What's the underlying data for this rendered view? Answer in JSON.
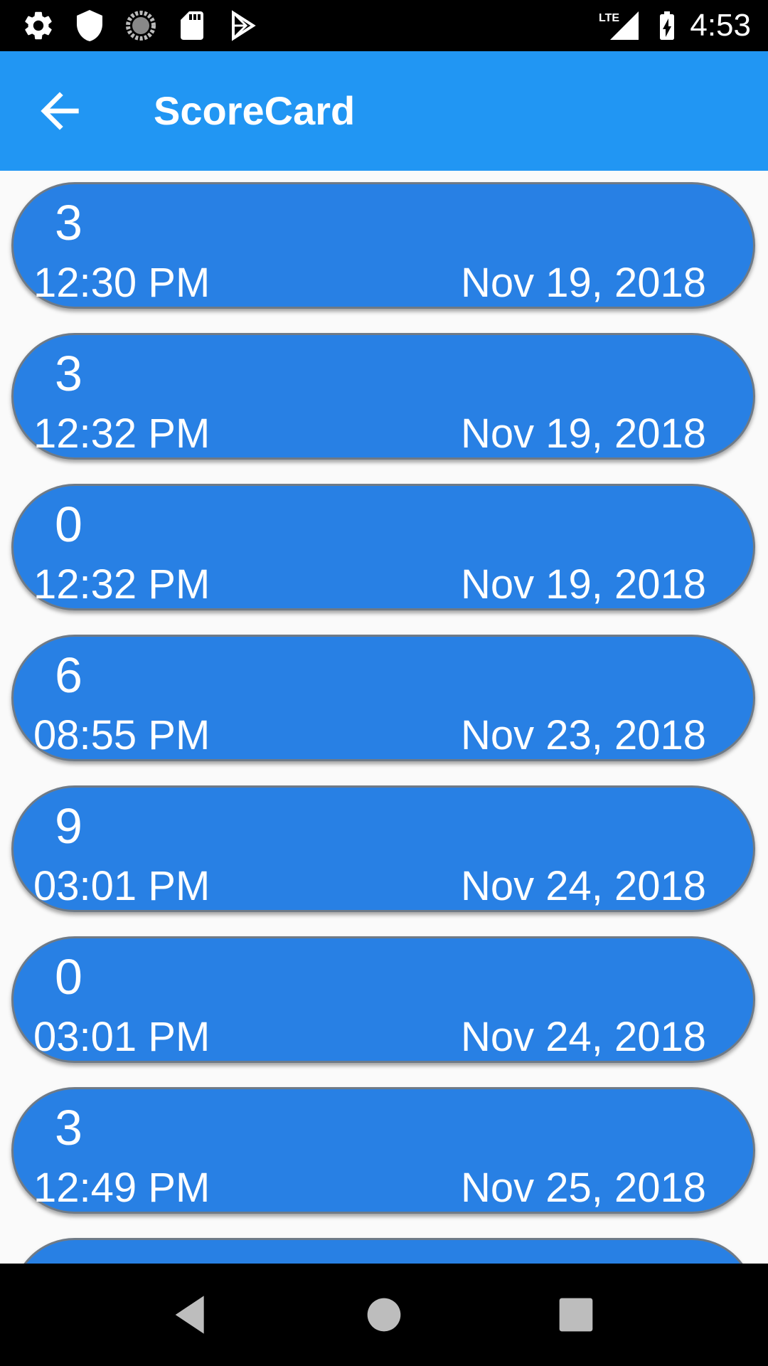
{
  "status_bar": {
    "time": "4:53",
    "left_icons": [
      "gear-icon",
      "shield-icon",
      "sync-spinner-icon",
      "sd-card-icon",
      "play-store-icon"
    ],
    "right_icons": [
      "lte-signal-icon",
      "battery-charging-icon"
    ],
    "network_label": "LTE"
  },
  "app_bar": {
    "title": "ScoreCard",
    "back_icon": "arrow-back-icon",
    "color": "#2196f3"
  },
  "score_list": {
    "card_color": "#2880e4",
    "items": [
      {
        "score": "3",
        "time": "12:30 PM",
        "date": "Nov 19, 2018"
      },
      {
        "score": "3",
        "time": "12:32 PM",
        "date": "Nov 19, 2018"
      },
      {
        "score": "0",
        "time": "12:32 PM",
        "date": "Nov 19, 2018"
      },
      {
        "score": "6",
        "time": "08:55 PM",
        "date": "Nov 23, 2018"
      },
      {
        "score": "9",
        "time": "03:01 PM",
        "date": "Nov 24, 2018"
      },
      {
        "score": "0",
        "time": "03:01 PM",
        "date": "Nov 24, 2018"
      },
      {
        "score": "3",
        "time": "12:49 PM",
        "date": "Nov 25, 2018"
      },
      {
        "score": "",
        "time": "",
        "date": ""
      }
    ]
  },
  "nav_bar": {
    "buttons": [
      "nav-back-icon",
      "nav-home-icon",
      "nav-recents-icon"
    ]
  }
}
